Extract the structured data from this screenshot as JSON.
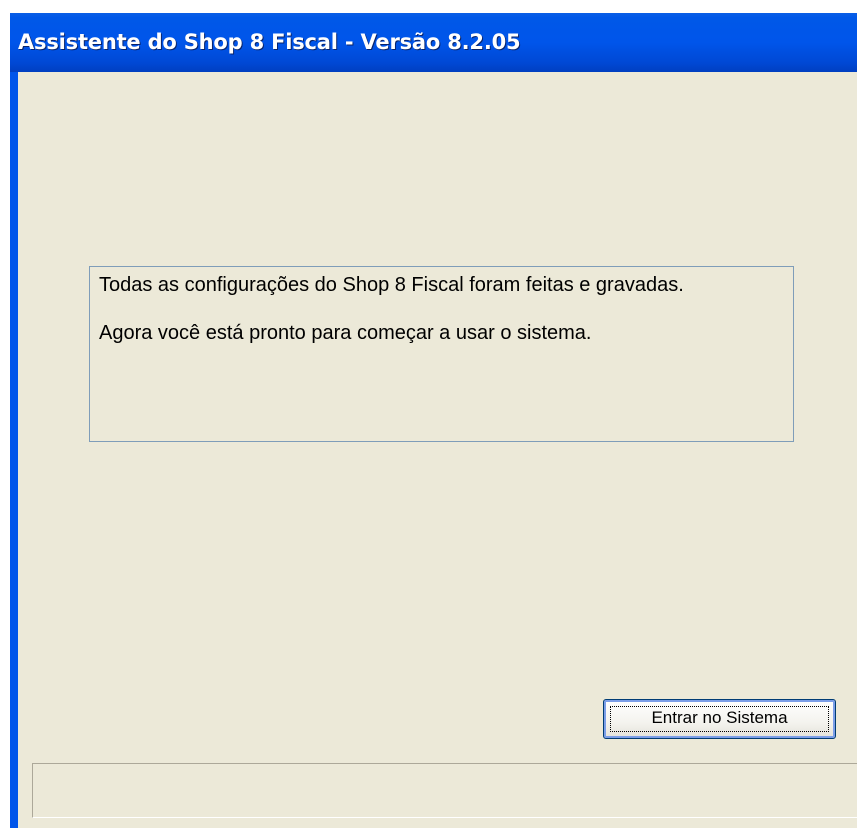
{
  "window": {
    "title": "Assistente do Shop 8 Fiscal - Versão 8.2.05"
  },
  "message": {
    "line1": "Todas as configurações do Shop 8 Fiscal foram feitas e gravadas.",
    "line2": "Agora você está pronto para começar a usar o sistema."
  },
  "buttons": {
    "enter_label": "Entrar no Sistema"
  },
  "status_bar": {
    "text": ""
  },
  "colors": {
    "titlebar": "#0055ea",
    "window_background": "#ece9d8",
    "message_border": "#7f9db9"
  }
}
